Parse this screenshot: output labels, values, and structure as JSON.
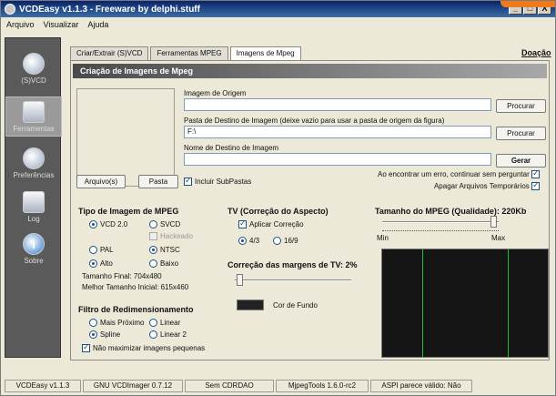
{
  "window": {
    "title": "VCDEasy v1.1.3 - Freeware by delphi.stuff",
    "min": "_",
    "max": "□",
    "close": "X"
  },
  "menu": [
    "Arquivo",
    "Visualizar",
    "Ajuda"
  ],
  "sidebar": {
    "items": [
      {
        "label": "(S)VCD",
        "icon": "disc-icon"
      },
      {
        "label": "Ferramentas",
        "icon": "tools-icon"
      },
      {
        "label": "Preferências",
        "icon": "preferences-icon"
      },
      {
        "label": "Log",
        "icon": "log-icon"
      },
      {
        "label": "Sobre",
        "icon": "info-icon"
      }
    ]
  },
  "tabs": [
    "Criar/Extrair (S)VCD",
    "Ferramentas MPEG",
    "Imagens de Mpeg"
  ],
  "donation": "Doação",
  "panel": {
    "header": "Criação de Imagens de Mpeg",
    "origin_label": "Imagem de Origem",
    "origin_value": "",
    "browse1": "Procurar",
    "dest_label": "Pasta de Destino de Imagem (deixe vazio para usar a pasta de origem da figura)",
    "dest_value": "F:\\",
    "browse2": "Procurar",
    "name_label": "Nome de Destino de Imagem",
    "name_value": "",
    "generate": "Gerar",
    "files_btn": "Arquivo(s)",
    "folder_btn": "Pasta",
    "subfolders": "Incluir SubPastas",
    "continue_on_error": "Ao encontrar um erro, continuar sem perguntar",
    "delete_temp": "Apagar Arquivos Temporários"
  },
  "type_section": {
    "title": "Tipo de Imagem de MPEG",
    "vcd": "VCD 2.0",
    "svcd": "SVCD",
    "hacked": "Hackeado",
    "pal": "PAL",
    "ntsc": "NTSC",
    "alto": "Alto",
    "baixo": "Baixo",
    "final_size": "Tamanho Final: 704x480",
    "best_size": "Melhor Tamanho Inicial: 615x460"
  },
  "filter_section": {
    "title": "Filtro de Redimensionamento",
    "nearest": "Mais Próximo",
    "linear": "Linear",
    "spline": "Spline",
    "linear2": "Linear 2",
    "no_maximize": "Não maximizar imagens pequenas"
  },
  "tv_section": {
    "title": "TV (Correção do Aspecto)",
    "apply": "Aplicar Correção",
    "r43": "4/3",
    "r169": "16/9",
    "margins_title": "Correção das margens de TV: 2%",
    "margin_level": 0.02,
    "bg_color_label": "Cor de Fundo",
    "bg_color": "#222222"
  },
  "size_section": {
    "title": "Tamanho do MPEG (Qualidade): 220Kb",
    "min": "Min",
    "max": "Max",
    "quality_level": 0.98
  },
  "status": [
    "VCDEasy v1.1.3",
    "GNU VCDImager 0.7.12",
    "Sem CDRDAO",
    "MjpegTools 1.6.0-rc2",
    "ASPI parece válido: Não"
  ]
}
